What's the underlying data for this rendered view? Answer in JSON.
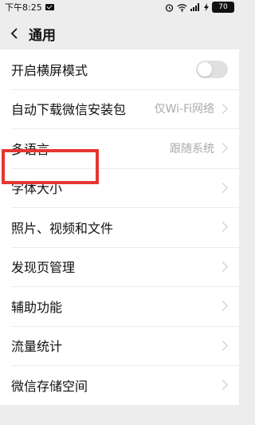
{
  "status_bar": {
    "time": "下午8:25",
    "battery": "70",
    "icons": [
      "mail-icon",
      "alarm-icon",
      "wifi-icon",
      "signal-icon",
      "charging-icon",
      "battery-icon"
    ]
  },
  "header": {
    "back_icon": "chevron-left-icon",
    "title": "通用"
  },
  "settings": [
    {
      "label": "开启横屏模式",
      "toggle": false
    },
    {
      "label": "自动下载微信安装包",
      "value": "仅Wi-Fi网络"
    },
    {
      "label": "多语言",
      "value": "跟随系统"
    },
    {
      "label": "字体大小",
      "value": ""
    },
    {
      "label": "照片、视频和文件",
      "value": ""
    },
    {
      "label": "发现页管理",
      "value": ""
    },
    {
      "label": "辅助功能",
      "value": ""
    },
    {
      "label": "流量统计",
      "value": ""
    },
    {
      "label": "微信存储空间",
      "value": ""
    }
  ],
  "highlight_color": "#e63630"
}
